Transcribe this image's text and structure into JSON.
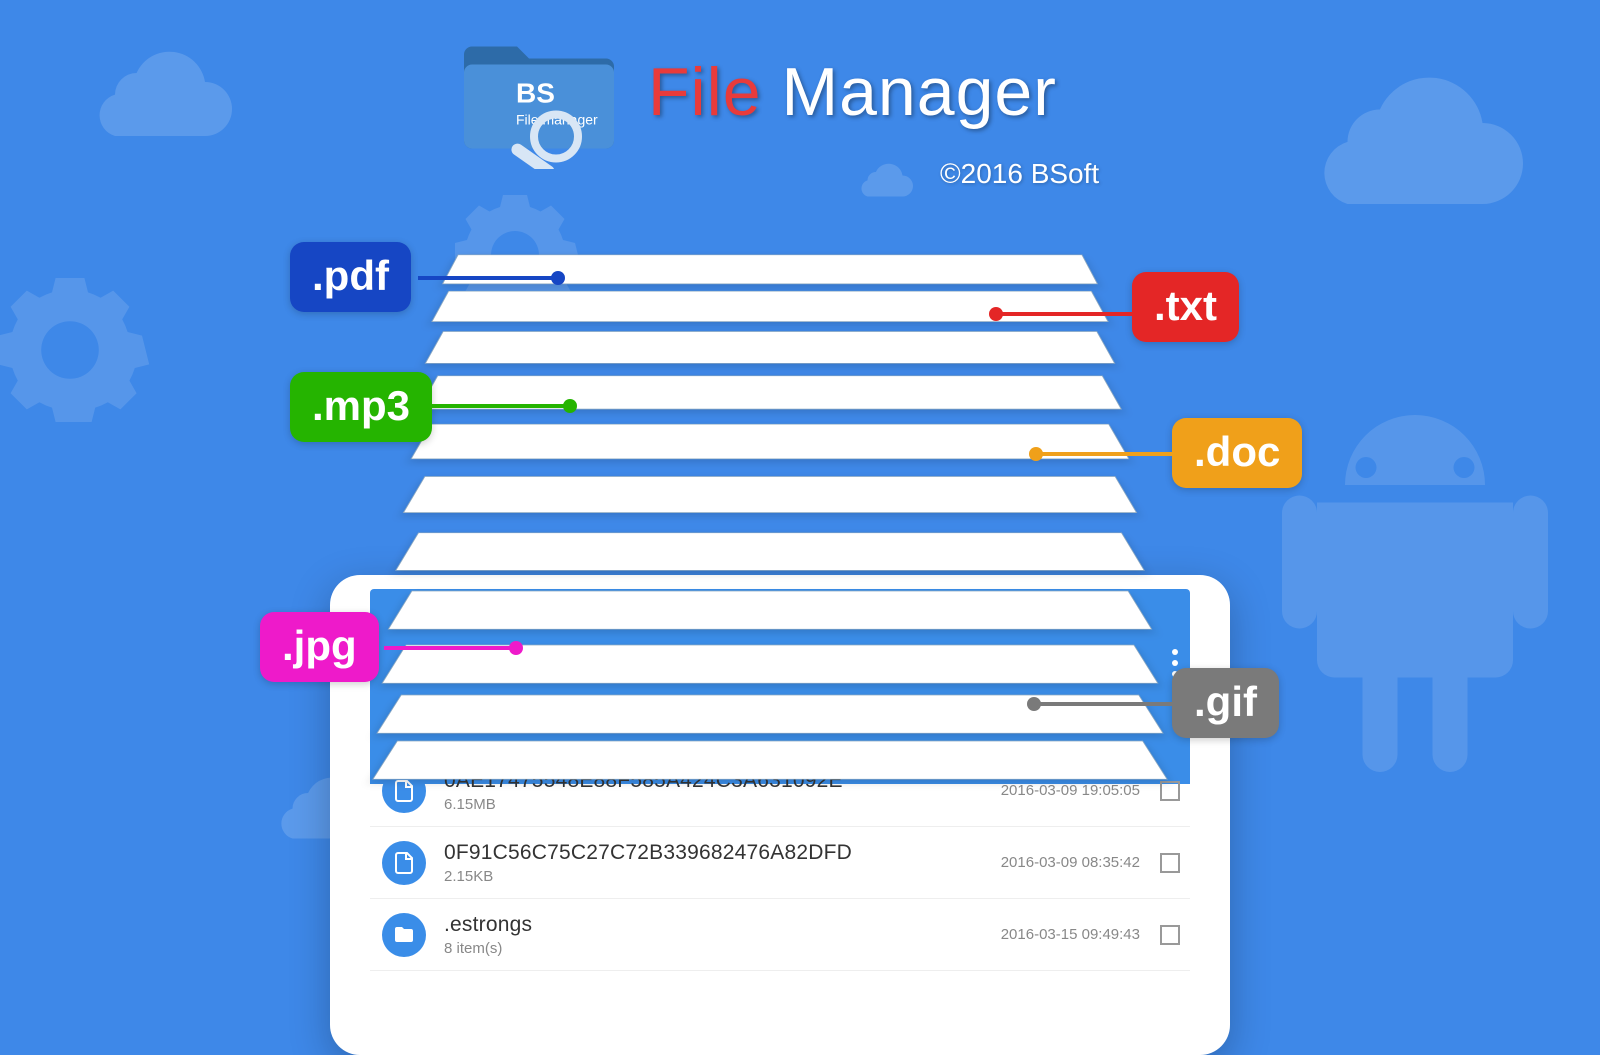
{
  "app": {
    "logo_text_top": "BS",
    "logo_text_bottom": "File manager",
    "title_file": "File",
    "title_manager": " Manager",
    "copyright": "©2016  BSoft"
  },
  "badges": {
    "pdf": {
      "label": ".pdf",
      "color": "#1646c4"
    },
    "txt": {
      "label": ".txt",
      "color": "#e42626"
    },
    "mp3": {
      "label": ".mp3",
      "color": "#25b400"
    },
    "doc": {
      "label": ".doc",
      "color": "#f0a01a"
    },
    "jpg": {
      "label": ".jpg",
      "color": "#ee1aca"
    },
    "gif": {
      "label": ".gif",
      "color": "#7a7a7a"
    }
  },
  "files": [
    {
      "name": "0AE17475548E88F585A424C3A631092E",
      "size": "6.15MB",
      "date": "2016-03-09 19:05:05",
      "icon": "file"
    },
    {
      "name": "0F91C56C75C27C72B339682476A82DFD",
      "size": "2.15KB",
      "date": "2016-03-09 08:35:42",
      "icon": "file"
    },
    {
      "name": ".estrongs",
      "size": "8 item(s)",
      "date": "2016-03-15 09:49:43",
      "icon": "folder"
    }
  ]
}
